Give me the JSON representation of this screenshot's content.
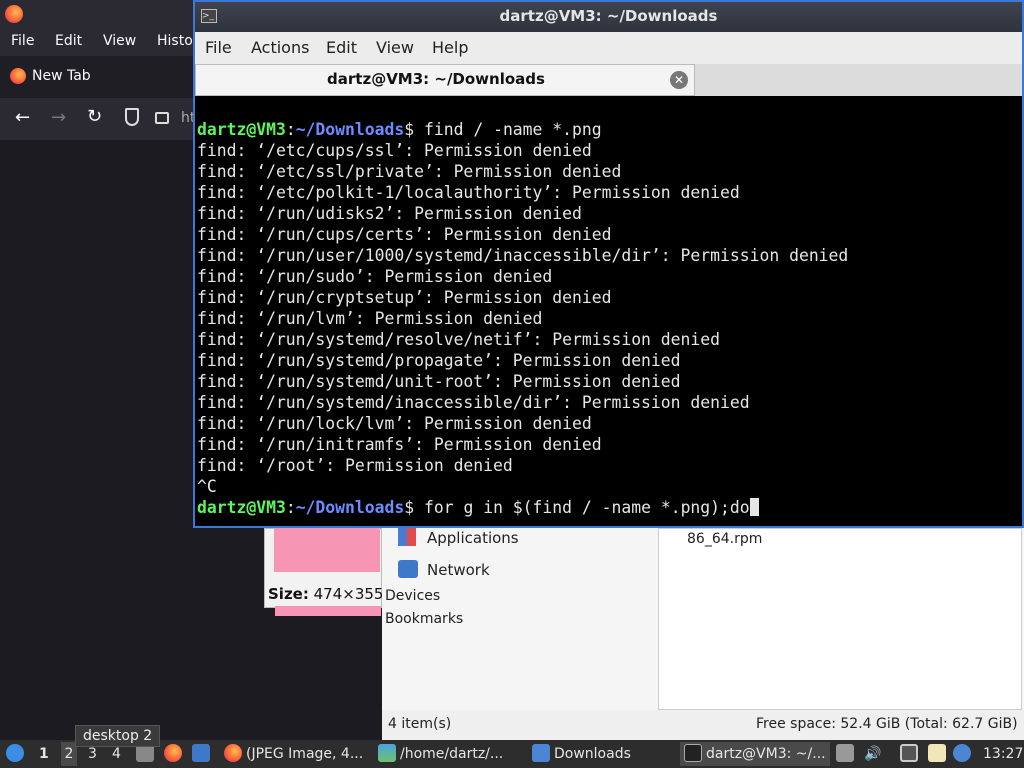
{
  "firefox": {
    "menu": [
      "File",
      "Edit",
      "View",
      "Histo"
    ],
    "tab_label": "New Tab",
    "url_fragment": "ht"
  },
  "image_viewer": {
    "size_label": "Size:",
    "size_value": "474×355"
  },
  "file_manager": {
    "places": [
      "Applications",
      "Network"
    ],
    "sections": [
      "Devices",
      "Bookmarks"
    ],
    "file_name": "86_64.rpm",
    "status_items": "4 item(s)",
    "status_free": "Free space: 52.4 GiB (Total: 62.7 GiB)"
  },
  "terminal": {
    "title": "dartz@VM3: ~/Downloads",
    "menu": [
      "File",
      "Actions",
      "Edit",
      "View",
      "Help"
    ],
    "tab_label": "dartz@VM3: ~/Downloads",
    "prompt_user": "dartz@VM3",
    "prompt_sep": ":",
    "prompt_path": "~/Downloads",
    "prompt_dollar": "$ ",
    "command1": "find / -name *.png",
    "output": [
      "find: ‘/etc/cups/ssl’: Permission denied",
      "find: ‘/etc/ssl/private’: Permission denied",
      "find: ‘/etc/polkit-1/localauthority’: Permission denied",
      "find: ‘/run/udisks2’: Permission denied",
      "find: ‘/run/cups/certs’: Permission denied",
      "find: ‘/run/user/1000/systemd/inaccessible/dir’: Permission denied",
      "find: ‘/run/sudo’: Permission denied",
      "find: ‘/run/cryptsetup’: Permission denied",
      "find: ‘/run/lvm’: Permission denied",
      "find: ‘/run/systemd/resolve/netif’: Permission denied",
      "find: ‘/run/systemd/propagate’: Permission denied",
      "find: ‘/run/systemd/unit-root’: Permission denied",
      "find: ‘/run/systemd/inaccessible/dir’: Permission denied",
      "find: ‘/run/lock/lvm’: Permission denied",
      "find: ‘/run/initramfs’: Permission denied",
      "find: ‘/root’: Permission denied",
      "^C"
    ],
    "command2": "for g in $(find / -name *.png);do"
  },
  "taskbar": {
    "desktops": [
      "1",
      "2",
      "3",
      "4"
    ],
    "tooltip": "desktop 2",
    "windows": [
      "(JPEG Image, 4...",
      "/home/dartz/...",
      "Downloads",
      "dartz@VM3: ~/..."
    ],
    "clock": "13:27"
  },
  "colors": {
    "terminal_green": "#5ff55f",
    "terminal_blue": "#6c8cff",
    "accent_border": "#3c78d8"
  }
}
